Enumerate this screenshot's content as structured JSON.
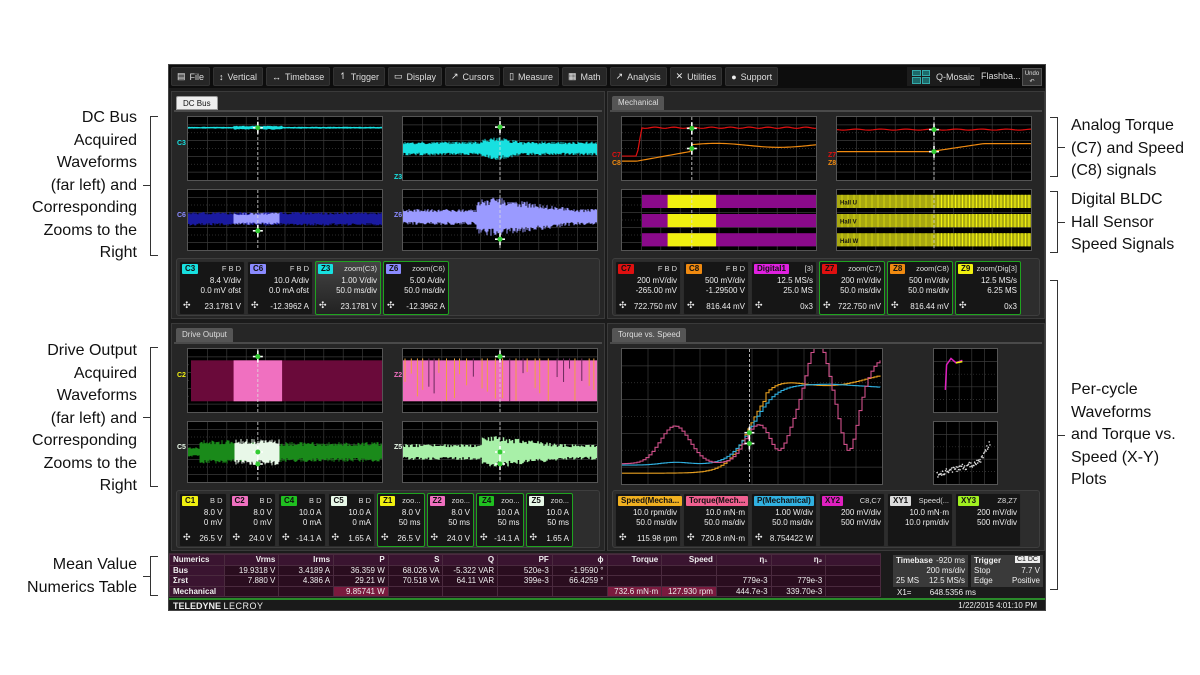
{
  "annotations": {
    "dc_bus": "DC Bus Acquired Waveforms (far left) and Corresponding Zooms to the Right",
    "dc_bus_lines": [
      "DC Bus",
      "Acquired",
      "Waveforms",
      "(far left) and",
      "Corresponding",
      "Zooms to the",
      "Right"
    ],
    "drive_output_lines": [
      "Drive Output",
      "Acquired",
      "Waveforms",
      "(far left) and",
      "Corresponding",
      "Zooms to the",
      "Right"
    ],
    "mean_value_lines": [
      "Mean Value",
      "Numerics Table"
    ],
    "analog_lines": [
      "Analog Torque",
      "(C7) and Speed",
      "(C8) signals"
    ],
    "digital_lines": [
      "Digital BLDC",
      "Hall Sensor",
      "Speed Signals"
    ],
    "percycle_lines": [
      "Per-cycle",
      "Waveforms",
      "and Torque vs.",
      "Speed (X-Y)",
      "Plots"
    ]
  },
  "menu": [
    {
      "label": "File",
      "icon": "clipboard-icon",
      "glyph": "▤"
    },
    {
      "label": "Vertical",
      "icon": "vertical-arrow-icon",
      "glyph": "↕"
    },
    {
      "label": "Timebase",
      "icon": "horizontal-arrow-icon",
      "glyph": "↔"
    },
    {
      "label": "Trigger",
      "icon": "trigger-icon",
      "glyph": "↿"
    },
    {
      "label": "Display",
      "icon": "display-icon",
      "glyph": "▭"
    },
    {
      "label": "Cursors",
      "icon": "cursor-icon",
      "glyph": "↗"
    },
    {
      "label": "Measure",
      "icon": "measure-icon",
      "glyph": "▯"
    },
    {
      "label": "Math",
      "icon": "math-icon",
      "glyph": "▦"
    },
    {
      "label": "Analysis",
      "icon": "analysis-icon",
      "glyph": "↗"
    },
    {
      "label": "Utilities",
      "icon": "utilities-icon",
      "glyph": "✕"
    },
    {
      "label": "Support",
      "icon": "info-icon",
      "glyph": "●"
    }
  ],
  "toolbar_right": {
    "qmosaic": "Q-Mosaic",
    "flashback": "Flashba...",
    "undo": "Undo"
  },
  "panels": {
    "dc_bus": {
      "tab": "DC Bus",
      "trace_labels": {
        "c3": "C3",
        "c6": "C6",
        "z3": "Z3",
        "z6": "Z6"
      },
      "descriptors": [
        {
          "badge": "C3",
          "color": "#17e0e0",
          "hdr": "F B D",
          "l1": "8.4 V/div",
          "l2": "0.0 mV ofst",
          "val": "23.1781 V",
          "zoom": false
        },
        {
          "badge": "C6",
          "color": "#8a8aff",
          "hdr": "F B D",
          "l1": "10.0 A/div",
          "l2": "0.0 mA ofst",
          "val": "-12.3962 A",
          "zoom": false
        },
        {
          "badge": "Z3",
          "color": "#17e0e0",
          "hdr": "zoom(C3)",
          "l1": "1.00 V/div",
          "l2": "50.0 ms/div",
          "val": "23.1781 V",
          "zoom": true,
          "selected": true
        },
        {
          "badge": "Z6",
          "color": "#8a8aff",
          "hdr": "zoom(C6)",
          "l1": "5.00 A/div",
          "l2": "50.0 ms/div",
          "val": "-12.3962 A",
          "zoom": true
        }
      ]
    },
    "mechanical": {
      "tab": "Mechanical",
      "trace_labels": {
        "c7": "C7",
        "c8": "C8",
        "z7": "Z7",
        "z8": "Z8"
      },
      "hall_labels": [
        "Hall U",
        "Hall V",
        "Hall W"
      ],
      "descriptors": [
        {
          "badge": "C7",
          "color": "#e01010",
          "hdr": "F B D",
          "l1": "200 mV/div",
          "l2": "-265.00 mV",
          "val": "722.750 mV",
          "zoom": false
        },
        {
          "badge": "C8",
          "color": "#f08a10",
          "hdr": "F B D",
          "l1": "500 mV/div",
          "l2": "-1.29500 V",
          "val": "816.44 mV",
          "zoom": false
        },
        {
          "badge": "Digital1",
          "color": "#e020e0",
          "hdr": "[3]",
          "l1": "12.5 MS/s",
          "l2": "25.0 MS",
          "val": "0x3",
          "zoom": false
        },
        {
          "badge": "Z7",
          "color": "#e01010",
          "hdr": "zoom(C7)",
          "l1": "200 mV/div",
          "l2": "50.0 ms/div",
          "val": "722.750 mV",
          "zoom": true
        },
        {
          "badge": "Z8",
          "color": "#f08a10",
          "hdr": "zoom(C8)",
          "l1": "500 mV/div",
          "l2": "50.0 ms/div",
          "val": "816.44 mV",
          "zoom": true
        },
        {
          "badge": "Z9",
          "color": "#f0f010",
          "hdr": "zoom(Dig[3]",
          "l1": "12.5 MS/s",
          "l2": "6.25 MS",
          "val": "0x3",
          "zoom": true
        }
      ]
    },
    "drive_output": {
      "tab": "Drive Output",
      "trace_labels": {
        "c2": "C2",
        "c5": "C5",
        "z2": "Z2",
        "z5": "Z5"
      },
      "descriptors": [
        {
          "badge": "C1",
          "color": "#f0f010",
          "hdr": "B D",
          "l1": "8.0 V",
          "l2": "0 mV",
          "val": "26.5 V",
          "zoom": false
        },
        {
          "badge": "C2",
          "color": "#f070c0",
          "hdr": "B D",
          "l1": "8.0 V",
          "l2": "0 mV",
          "val": "24.0 V",
          "zoom": false
        },
        {
          "badge": "C4",
          "color": "#20c020",
          "hdr": "B D",
          "l1": "10.0 A",
          "l2": "0 mA",
          "val": "-14.1 A",
          "zoom": false
        },
        {
          "badge": "C5",
          "color": "#e8f8e8",
          "hdr": "B D",
          "l1": "10.0 A",
          "l2": "0 mA",
          "val": "1.65 A",
          "zoom": false
        },
        {
          "badge": "Z1",
          "color": "#f0f010",
          "hdr": "zoo...",
          "l1": "8.0 V",
          "l2": "50 ms",
          "val": "26.5 V",
          "zoom": true
        },
        {
          "badge": "Z2",
          "color": "#f070c0",
          "hdr": "zoo...",
          "l1": "8.0 V",
          "l2": "50 ms",
          "val": "24.0 V",
          "zoom": true
        },
        {
          "badge": "Z4",
          "color": "#20c020",
          "hdr": "zoo...",
          "l1": "10.0 A",
          "l2": "50 ms",
          "val": "-14.1 A",
          "zoom": true
        },
        {
          "badge": "Z5",
          "color": "#e8f8e8",
          "hdr": "zoo...",
          "l1": "10.0 A",
          "l2": "50 ms",
          "val": "1.65 A",
          "zoom": true
        }
      ]
    },
    "torque_speed": {
      "tab": "Torque vs. Speed",
      "descriptors": [
        {
          "badge": "Speed(Mecha...",
          "color": "#f0b020",
          "hdr": "",
          "l1": "10.0 rpm/div",
          "l2": "50.0 ms/div",
          "val": "115.98 rpm",
          "zoom": false
        },
        {
          "badge": "Torque(Mech...",
          "color": "#f06090",
          "hdr": "",
          "l1": "10.0 mN·m",
          "l2": "50.0 ms/div",
          "val": "720.8 mN·m",
          "zoom": false
        },
        {
          "badge": "P(Mechanical)",
          "color": "#30b0e0",
          "hdr": "",
          "l1": "1.00 W/div",
          "l2": "50.0 ms/div",
          "val": "8.754422 W",
          "zoom": false
        },
        {
          "badge": "XY2",
          "color": "#e020c0",
          "hdr": "C8,C7",
          "l1": "200 mV/div",
          "l2": "500 mV/div",
          "val": "",
          "zoom": false
        },
        {
          "badge": "XY1",
          "color": "#dddddd",
          "hdr": "Speed(...",
          "l1": "10.0 mN·m",
          "l2": "10.0 rpm/div",
          "val": "",
          "zoom": false
        },
        {
          "badge": "XY3",
          "color": "#a0f020",
          "hdr": "Z8,Z7",
          "l1": "200 mV/div",
          "l2": "500 mV/div",
          "val": "",
          "zoom": false
        }
      ]
    }
  },
  "numerics": {
    "headers": [
      "Numerics",
      "Vrms",
      "Irms",
      "P",
      "S",
      "Q",
      "PF",
      "ϕ",
      "Torque",
      "Speed",
      "η₁",
      "η₂",
      ""
    ],
    "rows": [
      [
        "Bus",
        "19.9318 V",
        "3.4189 A",
        "36.359 W",
        "68.026 VA",
        "-5.322 VAR",
        "520e-3",
        "-1.9590 °",
        "",
        "",
        "",
        "",
        ""
      ],
      [
        "Σrst",
        "7.880 V",
        "4.386 A",
        "29.21 W",
        "70.518 VA",
        "64.11 VAR",
        "399e-3",
        "66.4259 °",
        "",
        "",
        "779e-3",
        "779e-3",
        ""
      ],
      [
        "Mechanical",
        "",
        "",
        "9.85741 W",
        "",
        "",
        "",
        "",
        "732.6 mN·m",
        "127.930 rpm",
        "444.7e-3",
        "339.70e-3",
        ""
      ]
    ]
  },
  "timebase": {
    "label": "Timebase",
    "delay": "-920 ms",
    "per_div": "200 ms/div",
    "samples": "25 MS",
    "rate": "12.5 MS/s"
  },
  "trigger": {
    "label": "Trigger",
    "source": "C1 DC",
    "mode": "Stop",
    "level": "7.7 V",
    "type": "Edge",
    "slope": "Positive"
  },
  "cursor": {
    "label": "X1=",
    "value": "648.5356 ms"
  },
  "footer": {
    "brand_bold": "TELEDYNE",
    "brand_light": "LECROY",
    "datetime": "1/22/2015 4:01:10 PM"
  }
}
